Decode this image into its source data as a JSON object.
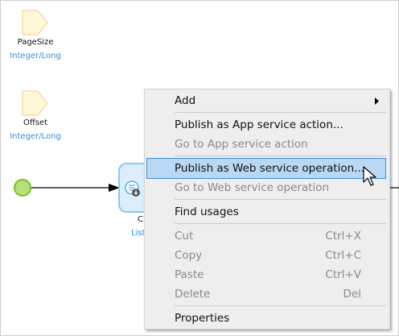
{
  "canvas": {
    "parameters": [
      {
        "name": "PageSize",
        "type": "Integer/Long"
      },
      {
        "name": "Offset",
        "type": "Integer/Long"
      }
    ],
    "activity": {
      "label_partial": "C",
      "type_partial": "List"
    },
    "colors": {
      "param_fill": "#fff8d6",
      "param_border": "#f7c88a",
      "start_fill": "#b5e07a",
      "start_border": "#7cc21f",
      "activity_fill": "#dcedfb",
      "activity_border": "#8cc8ef",
      "type_text": "#2a8fe0"
    }
  },
  "context_menu": {
    "items": [
      {
        "label": "Add",
        "submenu": true
      },
      {
        "label": "Publish as App service action...",
        "enabled": true
      },
      {
        "label": "Go to App service action",
        "enabled": false
      },
      {
        "label": "Publish as Web service operation...",
        "enabled": true,
        "highlighted": true
      },
      {
        "label": "Go to Web service operation",
        "enabled": false
      },
      {
        "label": "Find usages",
        "enabled": true
      },
      {
        "label": "Cut",
        "shortcut": "Ctrl+X",
        "enabled": false
      },
      {
        "label": "Copy",
        "shortcut": "Ctrl+C",
        "enabled": false
      },
      {
        "label": "Paste",
        "shortcut": "Ctrl+V",
        "enabled": false
      },
      {
        "label": "Delete",
        "shortcut": "Del",
        "enabled": false
      },
      {
        "label": "Properties",
        "enabled": true
      }
    ],
    "highlight_color": "#b9d8f3"
  }
}
